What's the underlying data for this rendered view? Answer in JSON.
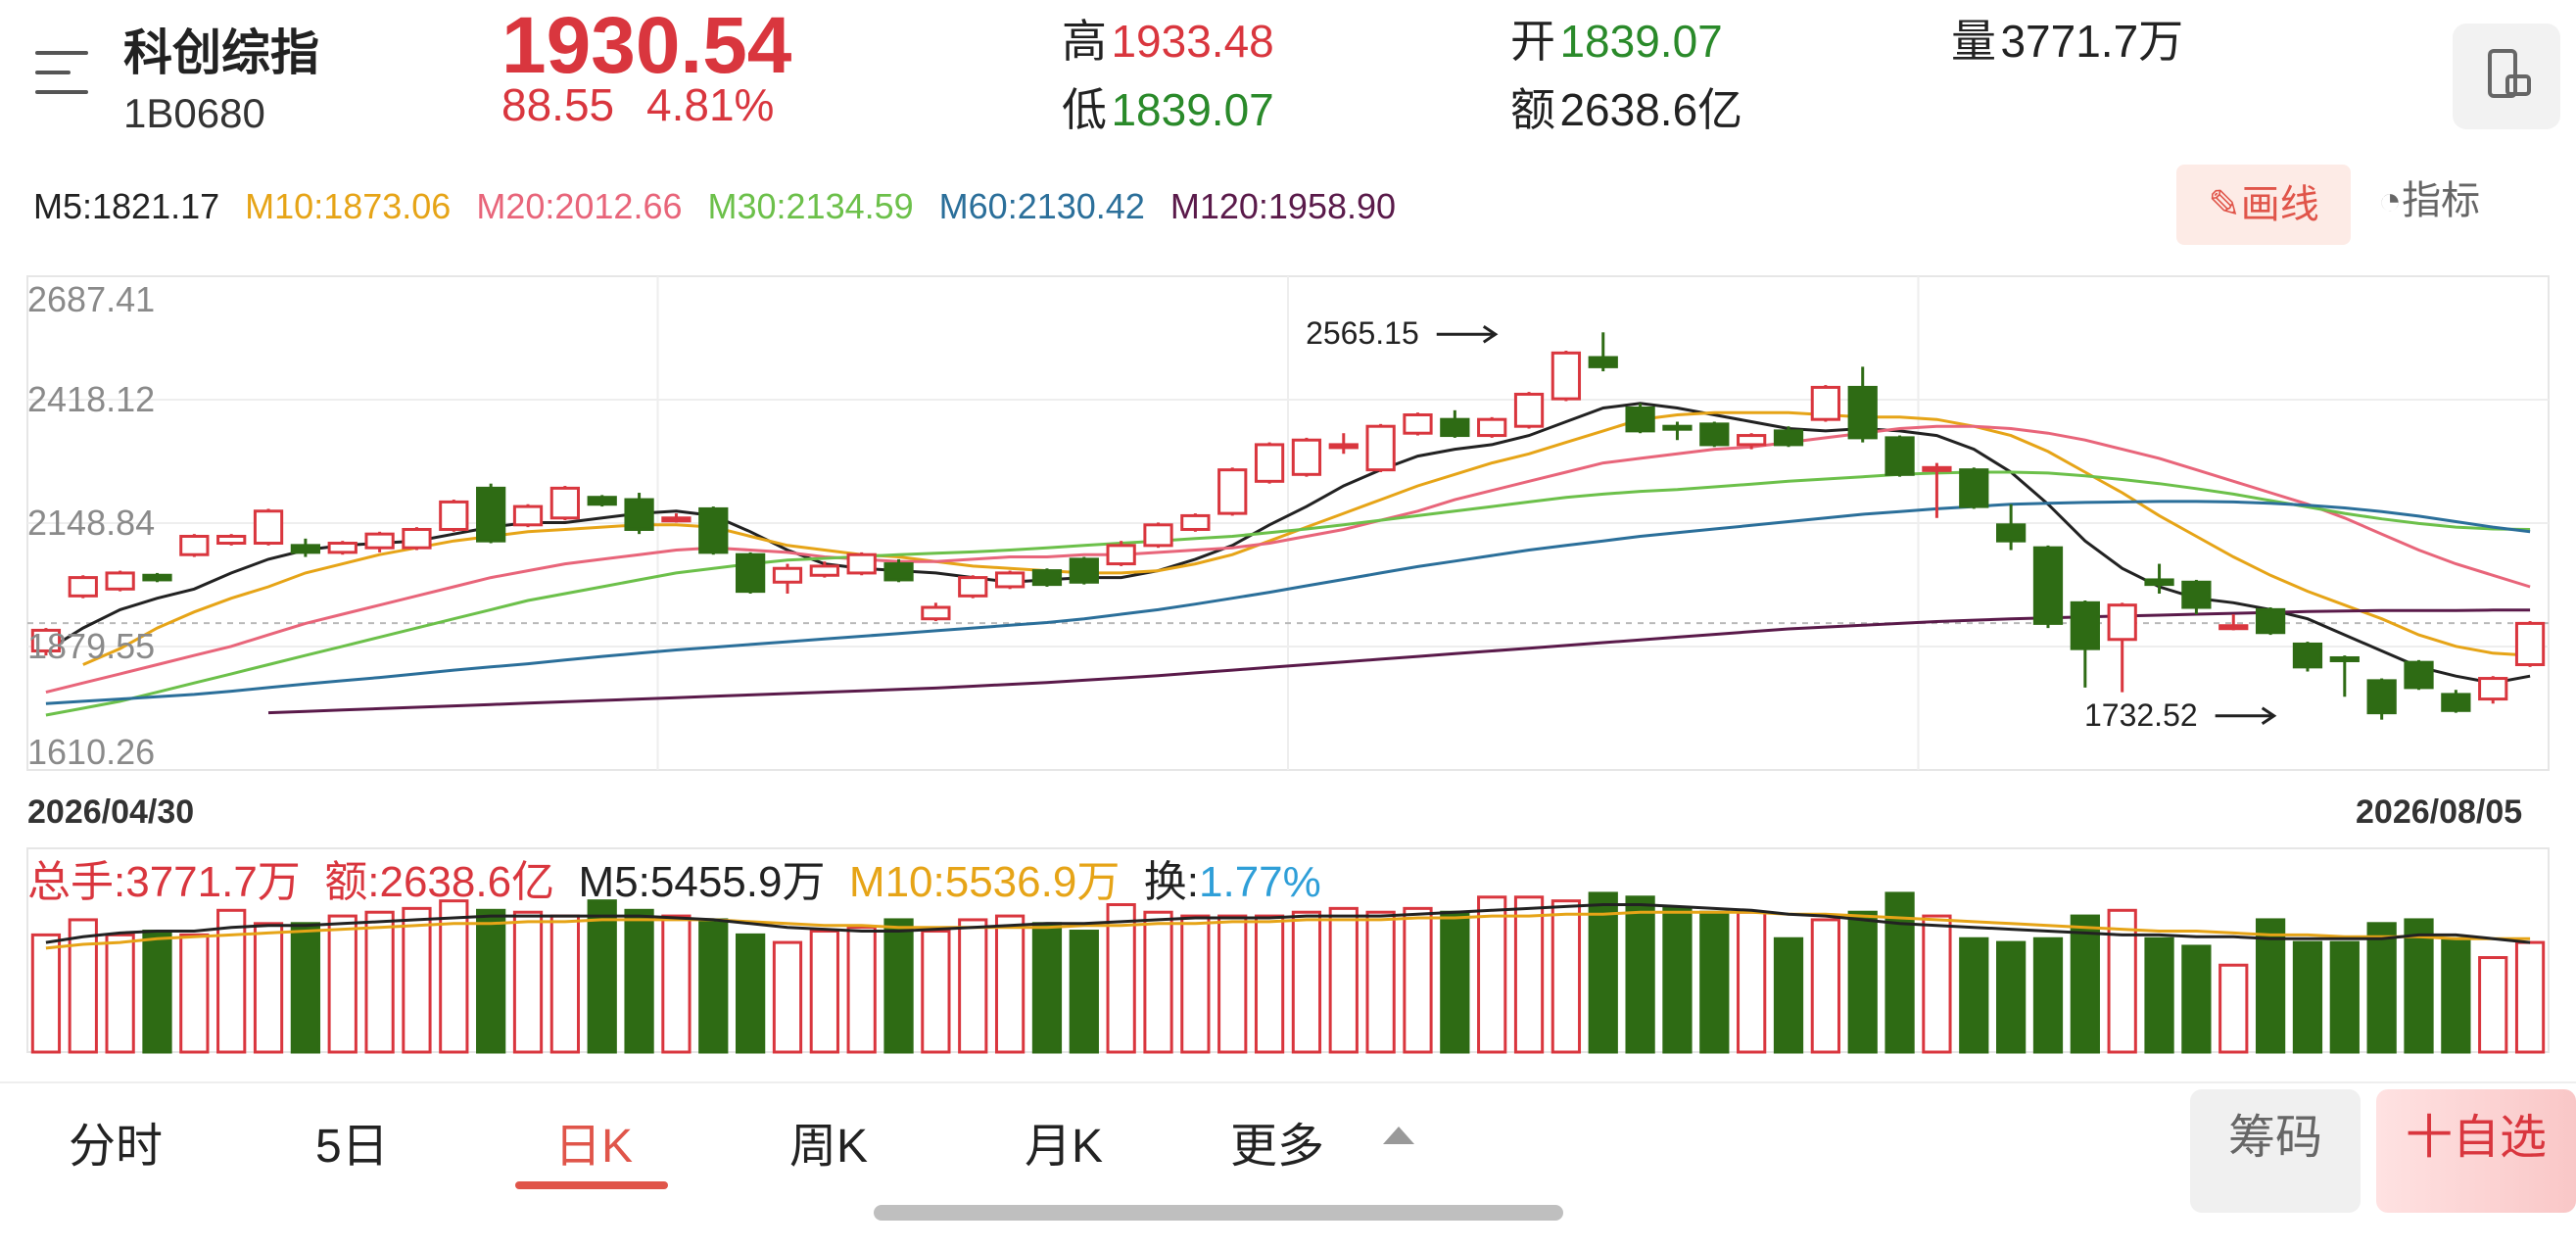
{
  "header": {
    "name": "科创综指",
    "code": "1B0680",
    "price": "1930.54",
    "change": "88.55",
    "change_pct": "4.81%",
    "high_label": "高",
    "high": "1933.48",
    "low_label": "低",
    "low": "1839.07",
    "open_label": "开",
    "open": "1839.07",
    "amount_label": "额",
    "amount": "2638.6亿",
    "volume_label": "量",
    "volume": "3771.7万"
  },
  "ma_legend": [
    {
      "text": "M5:1821.17",
      "color": "#222222"
    },
    {
      "text": "M10:1873.06",
      "color": "#e6a417"
    },
    {
      "text": "M20:2012.66",
      "color": "#e8657a"
    },
    {
      "text": "M30:2134.59",
      "color": "#6cc04a"
    },
    {
      "text": "M60:2130.42",
      "color": "#2b6f9a"
    },
    {
      "text": "M120:1958.90",
      "color": "#5a1a4a"
    }
  ],
  "toolbar": {
    "draw_label": "画线",
    "indicator_label": "指标"
  },
  "dates": {
    "start": "2026/04/30",
    "end": "2026/08/05"
  },
  "volume_legend": {
    "total": "总手:3771.7万",
    "amount": "额:2638.6亿",
    "m5": "M5:5455.9万",
    "m10": "M10:5536.9万",
    "turnover_label": "换:",
    "turnover": "1.77%"
  },
  "tabs": [
    "分时",
    "5日",
    "日K",
    "周K",
    "月K",
    "更多"
  ],
  "active_tab": "日K",
  "buttons": {
    "chips": "筹码",
    "watchlist": "十自选"
  },
  "colors": {
    "up": "#d9363e",
    "down": "#2e6b14",
    "ma5": "#222222",
    "ma10": "#e6a417",
    "ma20": "#e8657a",
    "ma30": "#6cc04a",
    "ma60": "#2b6f9a",
    "ma120": "#5a1a4a",
    "turnover": "#2f9fd8"
  },
  "chart_data": {
    "type": "candlestick",
    "y_axis_labels": [
      "2687.41",
      "2418.12",
      "2148.84",
      "1879.55",
      "1610.26"
    ],
    "ylim": [
      1610.26,
      2687.41
    ],
    "grid": true,
    "annotations": [
      {
        "text": "2565.15",
        "value": 2565.15
      },
      {
        "text": "1732.52",
        "value": 1732.52
      }
    ],
    "x_start": "2026/04/30",
    "x_end": "2026/08/05",
    "candles": [
      [
        1870,
        1915,
        1860,
        1920,
        1
      ],
      [
        1990,
        2030,
        1985,
        2035,
        1
      ],
      [
        2005,
        2040,
        2000,
        2045,
        1
      ],
      [
        2035,
        2025,
        2020,
        2040,
        0
      ],
      [
        2080,
        2120,
        2075,
        2125,
        1
      ],
      [
        2105,
        2120,
        2100,
        2125,
        1
      ],
      [
        2105,
        2175,
        2100,
        2180,
        1
      ],
      [
        2100,
        2085,
        2075,
        2115,
        0
      ],
      [
        2085,
        2105,
        2080,
        2110,
        1
      ],
      [
        2095,
        2125,
        2085,
        2130,
        1
      ],
      [
        2095,
        2135,
        2090,
        2140,
        1
      ],
      [
        2135,
        2195,
        2130,
        2200,
        1
      ],
      [
        2225,
        2110,
        2105,
        2235,
        0
      ],
      [
        2145,
        2185,
        2140,
        2190,
        1
      ],
      [
        2160,
        2225,
        2155,
        2230,
        1
      ],
      [
        2205,
        2190,
        2185,
        2210,
        0
      ],
      [
        2200,
        2135,
        2125,
        2215,
        0
      ],
      [
        2160,
        2160,
        2150,
        2170,
        1
      ],
      [
        2180,
        2085,
        2080,
        2185,
        0
      ],
      [
        2080,
        2000,
        1995,
        2085,
        0
      ],
      [
        2020,
        2050,
        1995,
        2060,
        1
      ],
      [
        2035,
        2055,
        2030,
        2065,
        1
      ],
      [
        2040,
        2080,
        2035,
        2085,
        1
      ],
      [
        2060,
        2025,
        2020,
        2070,
        0
      ],
      [
        1940,
        1965,
        1935,
        1975,
        1
      ],
      [
        1990,
        2030,
        1985,
        2035,
        1
      ],
      [
        2010,
        2040,
        2005,
        2045,
        1
      ],
      [
        2045,
        2015,
        2010,
        2050,
        0
      ],
      [
        2070,
        2020,
        2015,
        2075,
        0
      ],
      [
        2060,
        2100,
        2055,
        2110,
        1
      ],
      [
        2100,
        2145,
        2095,
        2150,
        1
      ],
      [
        2135,
        2165,
        2130,
        2170,
        1
      ],
      [
        2170,
        2265,
        2165,
        2270,
        1
      ],
      [
        2240,
        2320,
        2235,
        2325,
        1
      ],
      [
        2255,
        2330,
        2250,
        2335,
        1
      ],
      [
        2320,
        2320,
        2300,
        2345,
        1
      ],
      [
        2265,
        2360,
        2260,
        2365,
        1
      ],
      [
        2345,
        2385,
        2340,
        2390,
        1
      ],
      [
        2375,
        2340,
        2335,
        2395,
        0
      ],
      [
        2340,
        2375,
        2335,
        2380,
        1
      ],
      [
        2360,
        2430,
        2355,
        2435,
        1
      ],
      [
        2420,
        2520,
        2415,
        2525,
        1
      ],
      [
        2510,
        2490,
        2480,
        2565,
        0
      ],
      [
        2400,
        2350,
        2345,
        2410,
        0
      ],
      [
        2360,
        2355,
        2330,
        2370,
        0
      ],
      [
        2365,
        2320,
        2315,
        2370,
        0
      ],
      [
        2320,
        2340,
        2310,
        2345,
        1
      ],
      [
        2350,
        2320,
        2315,
        2360,
        0
      ],
      [
        2375,
        2445,
        2370,
        2450,
        1
      ],
      [
        2445,
        2335,
        2325,
        2490,
        0
      ],
      [
        2335,
        2255,
        2250,
        2340,
        0
      ],
      [
        2270,
        2270,
        2160,
        2280,
        1
      ],
      [
        2265,
        2185,
        2180,
        2270,
        0
      ],
      [
        2145,
        2110,
        2090,
        2190,
        0
      ],
      [
        2095,
        1930,
        1920,
        2100,
        0
      ],
      [
        1975,
        1875,
        1790,
        1980,
        0
      ],
      [
        1895,
        1970,
        1780,
        1975,
        1
      ],
      [
        2025,
        2015,
        1995,
        2060,
        0
      ],
      [
        2020,
        1965,
        1950,
        2025,
        0
      ],
      [
        1925,
        1925,
        1915,
        1950,
        1
      ],
      [
        1960,
        1910,
        1905,
        1965,
        0
      ],
      [
        1885,
        1835,
        1825,
        1890,
        0
      ],
      [
        1855,
        1850,
        1770,
        1860,
        0
      ],
      [
        1805,
        1735,
        1720,
        1810,
        0
      ],
      [
        1845,
        1790,
        1785,
        1850,
        0
      ],
      [
        1775,
        1740,
        1735,
        1785,
        0
      ],
      [
        1765,
        1810,
        1755,
        1815,
        1
      ],
      [
        1840,
        1930,
        1835,
        1935,
        1
      ]
    ],
    "candle_fields": [
      "open",
      "close",
      "low",
      "high",
      "up"
    ],
    "ma": {
      "M5": [
        1870,
        1920,
        1960,
        1985,
        2005,
        2040,
        2070,
        2090,
        2100,
        2105,
        2110,
        2125,
        2140,
        2150,
        2150,
        2160,
        2170,
        2175,
        2165,
        2130,
        2090,
        2060,
        2050,
        2045,
        2040,
        2030,
        2020,
        2025,
        2030,
        2030,
        2045,
        2070,
        2100,
        2145,
        2185,
        2230,
        2265,
        2295,
        2310,
        2320,
        2340,
        2370,
        2400,
        2410,
        2400,
        2385,
        2370,
        2355,
        2350,
        2355,
        2350,
        2340,
        2310,
        2260,
        2190,
        2110,
        2050,
        2010,
        1985,
        1975,
        1960,
        1940,
        1905,
        1870,
        1835,
        1815,
        1800,
        1815
      ],
      "M10": [
        null,
        1840,
        1875,
        1920,
        1955,
        1985,
        2010,
        2040,
        2060,
        2080,
        2095,
        2110,
        2120,
        2130,
        2135,
        2140,
        2145,
        2145,
        2140,
        2120,
        2100,
        2090,
        2080,
        2075,
        2065,
        2055,
        2050,
        2045,
        2040,
        2040,
        2045,
        2060,
        2080,
        2110,
        2140,
        2170,
        2200,
        2230,
        2255,
        2280,
        2300,
        2325,
        2350,
        2375,
        2385,
        2390,
        2390,
        2390,
        2385,
        2380,
        2380,
        2375,
        2360,
        2340,
        2305,
        2260,
        2215,
        2165,
        2120,
        2075,
        2035,
        2000,
        1970,
        1940,
        1905,
        1880,
        1865,
        1860
      ],
      "M20": [
        1780,
        1800,
        1820,
        1840,
        1860,
        1880,
        1905,
        1930,
        1950,
        1970,
        1990,
        2010,
        2030,
        2045,
        2060,
        2070,
        2080,
        2090,
        2095,
        2090,
        2085,
        2075,
        2070,
        2065,
        2065,
        2070,
        2075,
        2075,
        2080,
        2080,
        2085,
        2090,
        2095,
        2105,
        2120,
        2135,
        2155,
        2175,
        2200,
        2220,
        2240,
        2260,
        2280,
        2290,
        2300,
        2310,
        2315,
        2325,
        2335,
        2345,
        2355,
        2360,
        2360,
        2355,
        2345,
        2330,
        2310,
        2290,
        2265,
        2240,
        2215,
        2190,
        2160,
        2125,
        2090,
        2060,
        2035,
        2010
      ],
      "M30": [
        1730,
        1745,
        1760,
        1780,
        1800,
        1820,
        1840,
        1860,
        1880,
        1900,
        1920,
        1940,
        1960,
        1980,
        1995,
        2010,
        2025,
        2040,
        2050,
        2060,
        2068,
        2072,
        2076,
        2080,
        2083,
        2086,
        2090,
        2095,
        2100,
        2105,
        2110,
        2115,
        2120,
        2128,
        2136,
        2145,
        2155,
        2165,
        2175,
        2185,
        2195,
        2205,
        2212,
        2218,
        2222,
        2228,
        2234,
        2240,
        2245,
        2250,
        2255,
        2258,
        2260,
        2260,
        2258,
        2252,
        2244,
        2235,
        2224,
        2212,
        2198,
        2184,
        2170,
        2158,
        2148,
        2140,
        2136,
        2135
      ],
      "M60": [
        1755,
        1760,
        1765,
        1770,
        1775,
        1782,
        1790,
        1798,
        1805,
        1812,
        1820,
        1828,
        1835,
        1842,
        1850,
        1858,
        1865,
        1872,
        1878,
        1884,
        1890,
        1896,
        1902,
        1908,
        1914,
        1920,
        1926,
        1932,
        1940,
        1950,
        1960,
        1972,
        1985,
        1998,
        2012,
        2026,
        2040,
        2054,
        2066,
        2078,
        2090,
        2100,
        2110,
        2120,
        2128,
        2136,
        2144,
        2152,
        2160,
        2168,
        2174,
        2180,
        2185,
        2190,
        2192,
        2194,
        2195,
        2196,
        2196,
        2195,
        2192,
        2188,
        2182,
        2174,
        2164,
        2152,
        2140,
        2130
      ],
      "M120": [
        null,
        null,
        null,
        null,
        null,
        null,
        1735,
        1738,
        1741,
        1744,
        1747,
        1750,
        1753,
        1756,
        1759,
        1762,
        1765,
        1768,
        1771,
        1774,
        1777,
        1780,
        1783,
        1786,
        1789,
        1793,
        1797,
        1801,
        1806,
        1811,
        1816,
        1822,
        1828,
        1834,
        1840,
        1846,
        1852,
        1858,
        1864,
        1870,
        1876,
        1882,
        1888,
        1894,
        1900,
        1906,
        1912,
        1918,
        1922,
        1926,
        1930,
        1934,
        1937,
        1940,
        1942,
        1944,
        1946,
        1948,
        1950,
        1952,
        1954,
        1956,
        1957,
        1958,
        1958,
        1958,
        1959,
        1959
      ]
    },
    "volume": [
      62,
      70,
      62,
      64,
      62,
      75,
      68,
      68,
      72,
      74,
      76,
      80,
      75,
      74,
      72,
      80,
      75,
      72,
      70,
      62,
      58,
      64,
      66,
      70,
      64,
      70,
      72,
      68,
      64,
      78,
      74,
      72,
      72,
      72,
      74,
      76,
      74,
      76,
      74,
      82,
      82,
      80,
      84,
      82,
      76,
      74,
      74,
      60,
      70,
      74,
      84,
      72,
      60,
      58,
      60,
      72,
      75,
      60,
      56,
      46,
      70,
      58,
      58,
      68,
      70,
      60,
      50,
      58
    ],
    "vol_ma5": [
      58,
      61,
      63,
      64,
      64,
      66,
      67,
      67,
      68,
      69,
      70,
      71,
      72,
      72,
      72,
      72,
      72,
      71,
      70,
      68,
      66,
      65,
      64,
      64,
      65,
      66,
      67,
      68,
      68,
      69,
      70,
      71,
      71,
      71,
      72,
      72,
      72,
      73,
      74,
      75,
      76,
      77,
      78,
      78,
      77,
      76,
      75,
      73,
      72,
      70,
      68,
      67,
      66,
      65,
      64,
      63,
      62,
      62,
      61,
      61,
      60,
      60,
      60,
      60,
      62,
      62,
      60,
      58
    ],
    "vol_ma10": [
      55,
      57,
      58,
      60,
      61,
      62,
      63,
      64,
      65,
      66,
      67,
      68,
      68,
      69,
      69,
      70,
      70,
      70,
      70,
      69,
      68,
      67,
      67,
      66,
      66,
      66,
      66,
      66,
      67,
      67,
      68,
      68,
      69,
      69,
      70,
      70,
      70,
      71,
      71,
      72,
      72,
      73,
      73,
      74,
      74,
      74,
      74,
      73,
      73,
      72,
      71,
      70,
      69,
      68,
      67,
      66,
      65,
      64,
      64,
      63,
      62,
      62,
      61,
      61,
      61,
      60,
      60,
      60
    ]
  }
}
